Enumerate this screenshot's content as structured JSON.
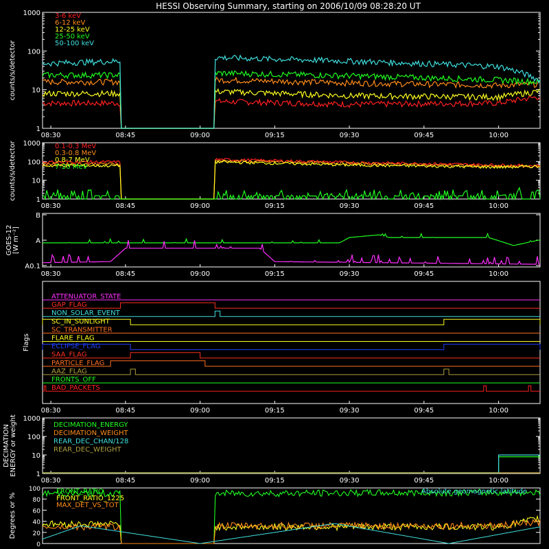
{
  "title": "HESSI Observing Summary, starting on 2006/10/09 08:28:20 UT",
  "time_ticks": [
    "08:30",
    "08:45",
    "09:00",
    "09:15",
    "09:30",
    "09:45",
    "10:00"
  ],
  "colors": {
    "red": "#ff2020",
    "orange": "#ff8c1a",
    "yellow": "#ffff20",
    "green": "#20ff20",
    "cyan": "#40e0e0",
    "magenta": "#ff30ff",
    "blue": "#2040ff",
    "olive": "#b0a040",
    "flag_red": "#ff3020",
    "flag_orange": "#ff7020",
    "frame": "#ffffff"
  },
  "chart_data": [
    {
      "id": "low_energy",
      "type": "line",
      "ylabel": "counts/s/detector",
      "yscale": "log",
      "ylim": [
        1,
        1000
      ],
      "yticks": [
        "1",
        "10",
        "100",
        "1000"
      ],
      "xlim": [
        "08:28:20",
        "10:08:20"
      ],
      "gap": [
        "08:44",
        "09:03"
      ],
      "series": [
        {
          "name": "3-6 keV",
          "color": "red",
          "x": [
            "08:28:20",
            "08:44",
            "09:03",
            "09:30",
            "10:00",
            "10:08"
          ],
          "values": [
            4.5,
            4.5,
            5.0,
            4.2,
            4.5,
            6.5
          ]
        },
        {
          "name": "6-12 keV",
          "color": "orange",
          "x": [
            "08:28:20",
            "08:44",
            "09:03",
            "09:30",
            "10:00",
            "10:08"
          ],
          "values": [
            16,
            16,
            18,
            15,
            13,
            14
          ]
        },
        {
          "name": "12-25 keV",
          "color": "yellow",
          "x": [
            "08:28:20",
            "08:44",
            "09:03",
            "09:30",
            "10:00",
            "10:08"
          ],
          "values": [
            8,
            8,
            9,
            7,
            6.5,
            9
          ]
        },
        {
          "name": "25-50 keV",
          "color": "green",
          "x": [
            "08:28:20",
            "08:44",
            "09:03",
            "09:30",
            "10:00",
            "10:08"
          ],
          "values": [
            24,
            24,
            27,
            23,
            18,
            16
          ]
        },
        {
          "name": "50-100 keV",
          "color": "cyan",
          "x": [
            "08:28:20",
            "08:44",
            "09:03",
            "09:30",
            "10:00",
            "10:08"
          ],
          "values": [
            48,
            55,
            68,
            55,
            40,
            18
          ]
        }
      ]
    },
    {
      "id": "high_energy",
      "type": "line",
      "ylabel": "counts/s/detector",
      "yscale": "log",
      "ylim": [
        1,
        1000
      ],
      "yticks": [
        "1",
        "10",
        "100",
        "1000"
      ],
      "xlim": [
        "08:28:20",
        "10:08:20"
      ],
      "gap": [
        "08:44",
        "09:03"
      ],
      "series": [
        {
          "name": "0.1-0.3 MeV",
          "color": "red",
          "x": [
            "08:28:20",
            "08:44",
            "09:03",
            "09:30",
            "10:00",
            "10:08"
          ],
          "values": [
            95,
            95,
            130,
            90,
            65,
            60
          ]
        },
        {
          "name": "0.3-0.8 MeV",
          "color": "orange",
          "x": [
            "08:28:20",
            "08:44",
            "09:03",
            "09:30",
            "10:00",
            "10:08"
          ],
          "values": [
            75,
            75,
            110,
            80,
            55,
            55
          ]
        },
        {
          "name": "0.8-7 MeV",
          "color": "yellow",
          "x": [
            "08:28:20",
            "08:44",
            "09:03",
            "09:30",
            "10:00",
            "10:08"
          ],
          "values": [
            60,
            60,
            95,
            65,
            50,
            55
          ]
        },
        {
          "name": "7-20 MeV",
          "color": "green",
          "x": [
            "08:28:20",
            "08:44",
            "09:03",
            "09:30",
            "10:00",
            "10:08"
          ],
          "values": [
            1.5,
            1.5,
            1.6,
            1.4,
            1.5,
            2.5
          ]
        }
      ]
    },
    {
      "id": "goes",
      "type": "line",
      "ylabel_lines": [
        "GOES-12",
        "[W m⁻²]"
      ],
      "yscale": "log",
      "yticks": [
        "A0.1",
        "A",
        "B"
      ],
      "xlim": [
        "08:28:20",
        "10:08:20"
      ],
      "series": [
        {
          "color": "green",
          "x": [
            "08:28:20",
            "09:28",
            "09:30",
            "09:36",
            "09:38",
            "09:58",
            "10:03",
            "10:08"
          ],
          "level": [
            0.45,
            0.45,
            0.55,
            0.6,
            0.55,
            0.55,
            0.4,
            0.5
          ]
        },
        {
          "color": "magenta",
          "x": [
            "08:28:20",
            "08:42",
            "08:45",
            "09:12",
            "09:15",
            "10:08"
          ],
          "level": [
            0.08,
            0.1,
            0.35,
            0.35,
            0.1,
            0.05
          ]
        }
      ]
    },
    {
      "id": "flags",
      "type": "table",
      "ylabel": "Flags",
      "flags": [
        {
          "name": "ATTENUATOR_STATE",
          "color": "magenta",
          "on": []
        },
        {
          "name": "GAP_FLAG",
          "color": "flag_red",
          "on": [
            [
              "08:44",
              "09:03"
            ]
          ]
        },
        {
          "name": "NON_SOLAR_EVENT",
          "color": "cyan",
          "on": [
            [
              "09:03",
              "09:04"
            ]
          ]
        },
        {
          "name": "SC_IN_SUNLIGHT",
          "color": "yellow",
          "on": [
            [
              "08:28:20",
              "08:46"
            ],
            [
              "09:49",
              "10:08:20"
            ]
          ]
        },
        {
          "name": "SC_TRANSMITTER",
          "color": "flag_orange",
          "on": []
        },
        {
          "name": "FLARE_FLAG",
          "color": "yellow",
          "on": []
        },
        {
          "name": "ECLIPSE_FLAG",
          "color": "blue",
          "on": [
            [
              "08:28:20",
              "08:46"
            ],
            [
              "09:49",
              "10:08:20"
            ]
          ]
        },
        {
          "name": "SAA_FLAG",
          "color": "flag_red",
          "on": [
            [
              "08:46",
              "09:00"
            ]
          ]
        },
        {
          "name": "PARTICLE_FLAG",
          "color": "flag_orange",
          "on": [
            [
              "08:42",
              "09:01"
            ]
          ]
        },
        {
          "name": "AAZ_FLAG",
          "color": "olive",
          "on": [
            [
              "08:46",
              "08:47"
            ],
            [
              "09:49",
              "09:50"
            ]
          ]
        },
        {
          "name": "FRONTS_OFF",
          "color": "green",
          "on": []
        },
        {
          "name": "BAD_PACKETS",
          "color": "red",
          "on": [
            [
              "08:28:40",
              "08:29"
            ],
            [
              "09:57",
              "09:57:30"
            ],
            [
              "10:06",
              "10:06:30"
            ]
          ]
        }
      ]
    },
    {
      "id": "decimation",
      "type": "line",
      "ylabel_lines": [
        "DECIMATION",
        "ENERGY or weight"
      ],
      "yscale": "log",
      "ylim": [
        1,
        1000
      ],
      "yticks": [
        "1",
        "10",
        "100",
        "1000"
      ],
      "series": [
        {
          "name": "DECIMATION_ENERGY",
          "color": "green",
          "x": [
            "08:28:20",
            "10:00",
            "10:00",
            "10:08:20"
          ],
          "values": [
            1,
            1,
            8,
            8
          ]
        },
        {
          "name": "DECIMATION_WEIGHT",
          "color": "orange",
          "x": [
            "08:28:20",
            "10:08:20"
          ],
          "values": [
            1,
            1
          ]
        },
        {
          "name": "REAR_DEC_CHAN/128",
          "color": "cyan",
          "x": [
            "08:28:20",
            "10:00",
            "10:00",
            "10:08:20"
          ],
          "values": [
            1,
            1,
            10,
            10
          ]
        },
        {
          "name": "REAR_DEC_WEIGHT",
          "color": "olive",
          "x": [
            "08:28:20",
            "10:08:20"
          ],
          "values": [
            1,
            1
          ]
        }
      ]
    },
    {
      "id": "ratios",
      "type": "line",
      "ylabel": "Degrees or %",
      "ylim": [
        0,
        100
      ],
      "yticks": [
        "0",
        "20",
        "40",
        "60",
        "80",
        "100"
      ],
      "annotation": "Absolute geomagnetic latitude",
      "series": [
        {
          "name": "FRONT_RATIO",
          "color": "green",
          "x": [
            "08:28:20",
            "08:44",
            "09:03",
            "10:08:20"
          ],
          "values": [
            90,
            90,
            90,
            92
          ]
        },
        {
          "name": "FRONT_RATIO_1225",
          "color": "yellow",
          "x": [
            "08:28:20",
            "08:44",
            "09:03",
            "10:00",
            "10:08:20"
          ],
          "values": [
            35,
            35,
            30,
            30,
            45
          ]
        },
        {
          "name": "MAX_DET_VS_TOT",
          "color": "orange",
          "x": [
            "08:28:20",
            "08:44",
            "09:03",
            "10:00",
            "10:08:20"
          ],
          "values": [
            30,
            30,
            32,
            32,
            38
          ]
        },
        {
          "name": "",
          "color": "cyan",
          "x": [
            "08:28:20",
            "08:36",
            "09:00",
            "09:27",
            "09:50",
            "10:08:20"
          ],
          "values": [
            8,
            32,
            0,
            36,
            0,
            30
          ]
        }
      ]
    }
  ]
}
